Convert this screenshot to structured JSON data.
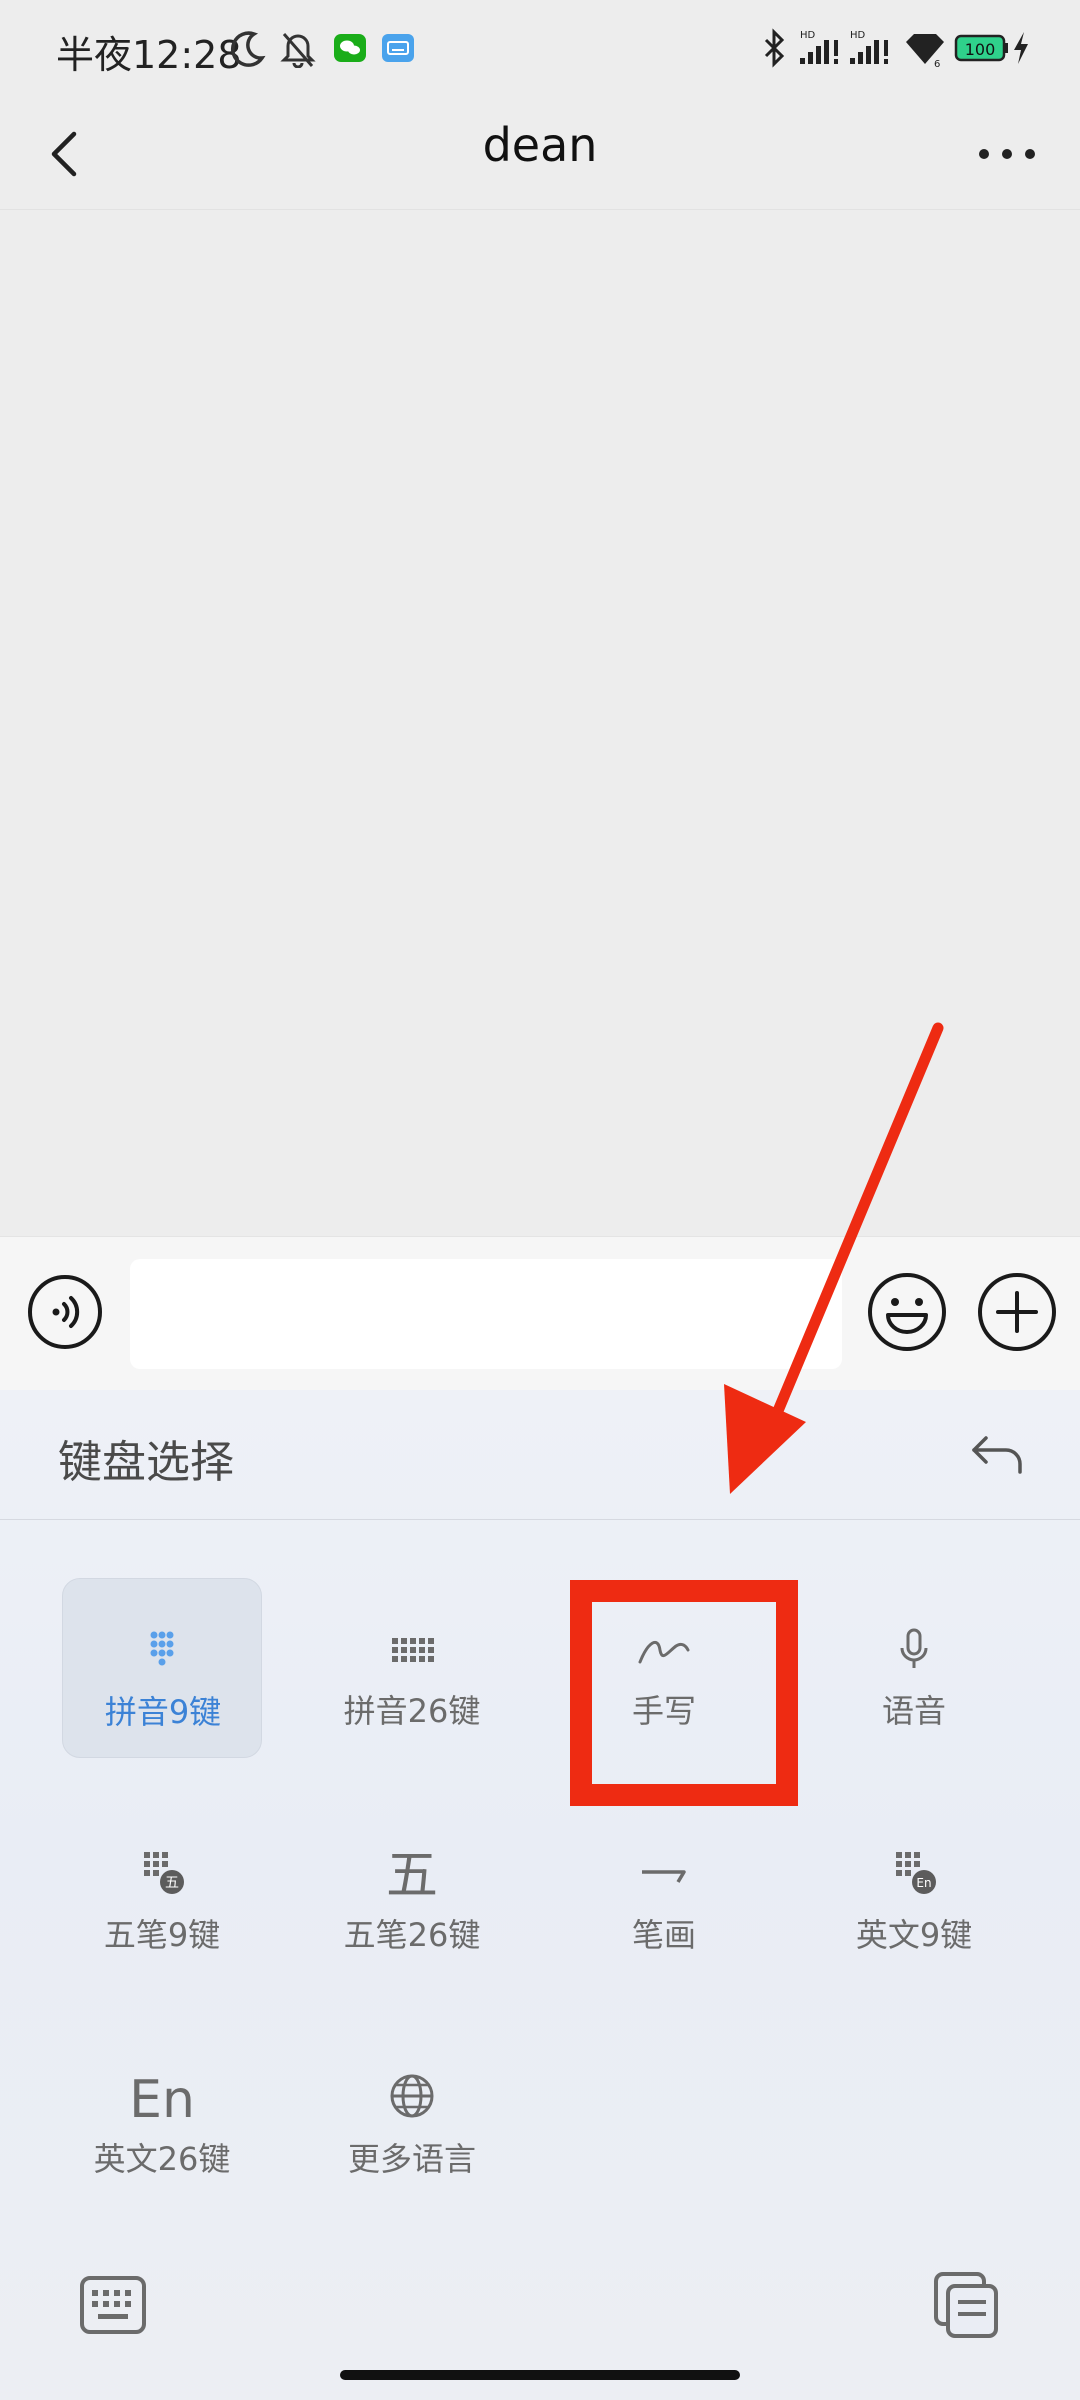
{
  "status_bar": {
    "time": "半夜12:28",
    "icons": [
      "moon-icon",
      "bell-off-icon",
      "wechat-icon",
      "keyboard-notification-icon",
      "bluetooth-icon",
      "signal-hd-1-icon",
      "signal-hd-2-icon",
      "wifi-icon",
      "battery-icon",
      "charging-icon"
    ],
    "battery_level": "100"
  },
  "header": {
    "title": "dean",
    "back_icon": "chevron-left-icon",
    "more_icon": "more-dots-icon"
  },
  "input_bar": {
    "voice_icon": "voice-input-icon",
    "message_value": "",
    "emoji_icon": "emoji-icon",
    "plus_icon": "plus-icon"
  },
  "keyboard_panel": {
    "title": "键盘选择",
    "return_icon": "return-arrow-icon",
    "options": [
      {
        "label": "拼音9键",
        "icon": "dots-grid-9-icon",
        "selected": true
      },
      {
        "label": "拼音26键",
        "icon": "dots-grid-26-icon",
        "selected": false
      },
      {
        "label": "手写",
        "icon": "handwriting-icon",
        "selected": false
      },
      {
        "label": "语音",
        "icon": "microphone-icon",
        "selected": false
      },
      {
        "label": "五笔9键",
        "icon": "wubi-9-icon",
        "badge": "五",
        "selected": false
      },
      {
        "label": "五笔26键",
        "icon": "wubi-26-icon",
        "glyph": "五",
        "selected": false
      },
      {
        "label": "笔画",
        "icon": "stroke-icon",
        "selected": false
      },
      {
        "label": "英文9键",
        "icon": "english-9-icon",
        "badge": "En",
        "selected": false
      },
      {
        "label": "英文26键",
        "icon": "english-26-icon",
        "glyph": "En",
        "selected": false
      },
      {
        "label": "更多语言",
        "icon": "globe-icon",
        "selected": false
      }
    ],
    "bottom_left_icon": "keyboard-icon",
    "bottom_right_icon": "clipboard-icon",
    "accent_color": "#3b82d6"
  },
  "annotation": {
    "highlight_target": "手写",
    "color": "#ee2b12"
  }
}
